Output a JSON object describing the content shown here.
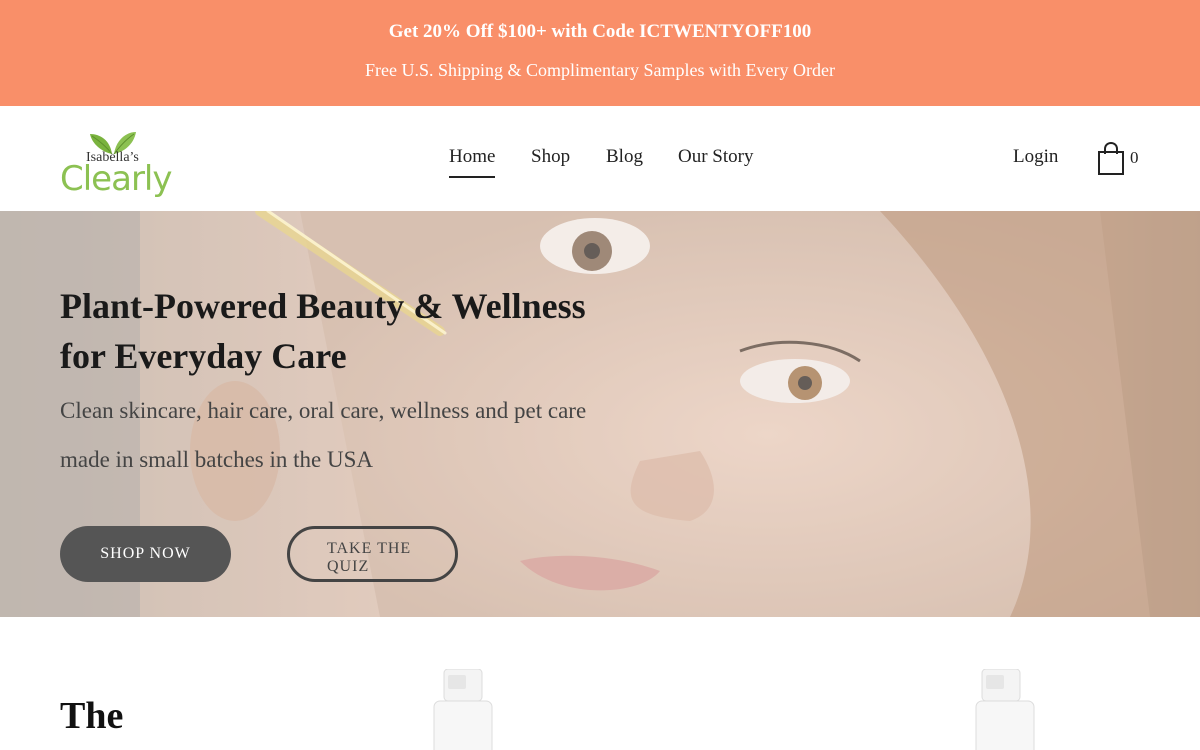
{
  "announcement": {
    "promo": "Get 20% Off $100+ with Code ICTWENTYOFF100",
    "shipping": "Free U.S. Shipping & Complimentary Samples with Every Order",
    "background_color": "#f98f69"
  },
  "header": {
    "logo": {
      "small_text": "Isabella’s",
      "brand_text": "Clearly",
      "brand_color": "#8cc152"
    },
    "nav": [
      {
        "label": "Home",
        "active": true
      },
      {
        "label": "Shop"
      },
      {
        "label": "Blog"
      },
      {
        "label": "Our Story"
      }
    ],
    "login_label": "Login",
    "cart_count": "0",
    "cart_icon": "shopping-bag-icon"
  },
  "hero": {
    "title": "Plant-Powered Beauty & Wellness for Everyday Care",
    "subtitle": "Clean skincare, hair care, oral care, wellness and pet care made in small batches in the USA",
    "primary_button": "SHOP NOW",
    "secondary_button": "TAKE THE QUIZ"
  },
  "featured": {
    "title": "The"
  }
}
